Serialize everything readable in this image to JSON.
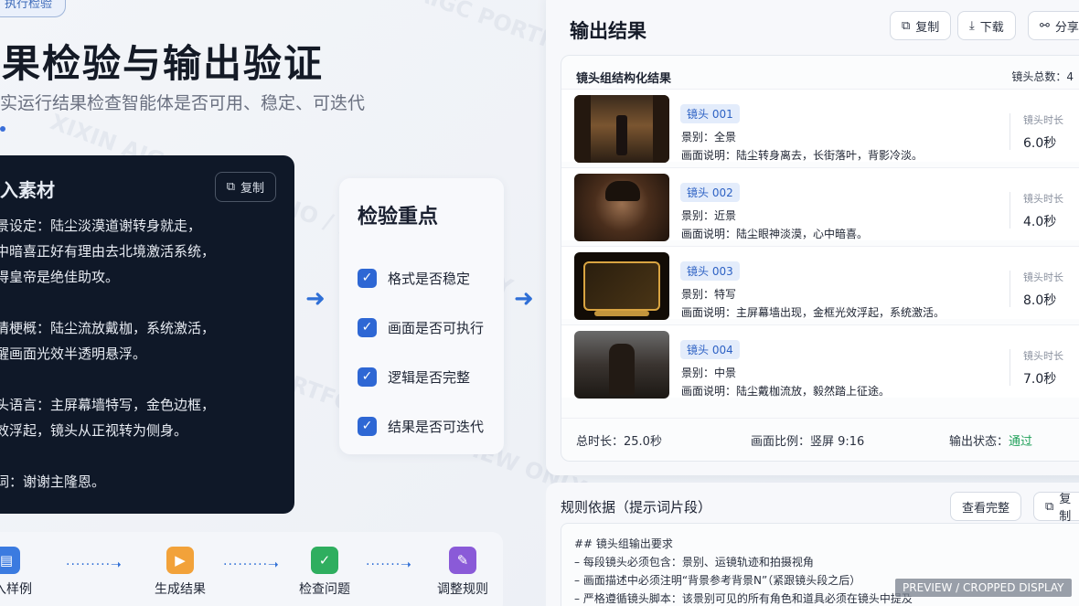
{
  "tag": "执行检验",
  "hero": {
    "title": "结果检验与输出验证",
    "subtitle": "真实运行结果检查智能体是否可用、稳定、可迭代"
  },
  "input": {
    "title": "输入素材",
    "copy_label": "复制",
    "paragraphs": [
      [
        "背景设定：陆尘淡漠道谢转身就走，",
        "心中暗喜正好有理由去北境激活系统，",
        "获得皇帝是绝佳助攻。"
      ],
      [
        "剧情梗概：陆尘流放戴枷，系统激活，",
        "提醒画面光效半透明悬浮。"
      ],
      [
        "镜头语言：主屏幕墙特写，金色边框，",
        "光效浮起，镜头从正视转为侧身。"
      ],
      [
        "台词：谢谢主隆恩。"
      ]
    ]
  },
  "focus": {
    "title": "检验重点",
    "items": [
      "格式是否稳定",
      "画面是否可执行",
      "逻辑是否完整",
      "结果是否可迭代"
    ]
  },
  "steps": {
    "items": [
      {
        "label": "输入样例",
        "color": "#3b7be0",
        "icon": "clipboard-icon"
      },
      {
        "label": "生成结果",
        "color": "#f2a23a",
        "icon": "clapper-icon"
      },
      {
        "label": "检查问题",
        "color": "#2fae5f",
        "icon": "shield-check-icon"
      },
      {
        "label": "调整规则",
        "color": "#8a5ad8",
        "icon": "edit-icon"
      }
    ]
  },
  "output": {
    "title": "输出结果",
    "buttons": {
      "copy": "复制",
      "download": "下载",
      "share": "分享"
    },
    "result_title": "镜头组结构化结果",
    "count_label": "镜头总数：4",
    "duration_label": "镜头时长",
    "shots": [
      {
        "tag": "镜头 001",
        "scene": "景别：全景",
        "desc": "画面说明：陆尘转身离去，长街落叶，背影冷淡。",
        "duration": "6.0秒"
      },
      {
        "tag": "镜头 002",
        "scene": "景别：近景",
        "desc": "画面说明：陆尘眼神淡漠，心中暗喜。",
        "duration": "4.0秒"
      },
      {
        "tag": "镜头 003",
        "scene": "景别：特写",
        "desc": "画面说明：主屏幕墙出现，金框光效浮起，系统激活。",
        "duration": "8.0秒"
      },
      {
        "tag": "镜头 004",
        "scene": "景别：中景",
        "desc": "画面说明：陆尘戴枷流放，毅然踏上征途。",
        "duration": "7.0秒"
      }
    ],
    "summary": {
      "total": "总时长：25.0秒",
      "ratio": "画面比例：竖屏 9:16",
      "status_label": "输出状态：",
      "status_value": "通过"
    }
  },
  "rules": {
    "title": "规则依据（提示词片段）",
    "view_all": "查看完整",
    "copy": "复制",
    "lines": [
      "## 镜头组输出要求",
      "– 每段镜头必须包含：景别、运镜轨迹和拍摄视角",
      "– 画面描述中必须注明“背景参考背景N”（紧跟镜头段之后）",
      "– 严格遵循镜头脚本：该景别可见的所有角色和道具必须在镜头中提及"
    ]
  },
  "badge": "PREVIEW / CROPPED DISPLAY",
  "watermarks": [
    "XIXIN AIGC PORTFOLIO / PREVIEW ONLY",
    "XiXin Preview 2025"
  ]
}
